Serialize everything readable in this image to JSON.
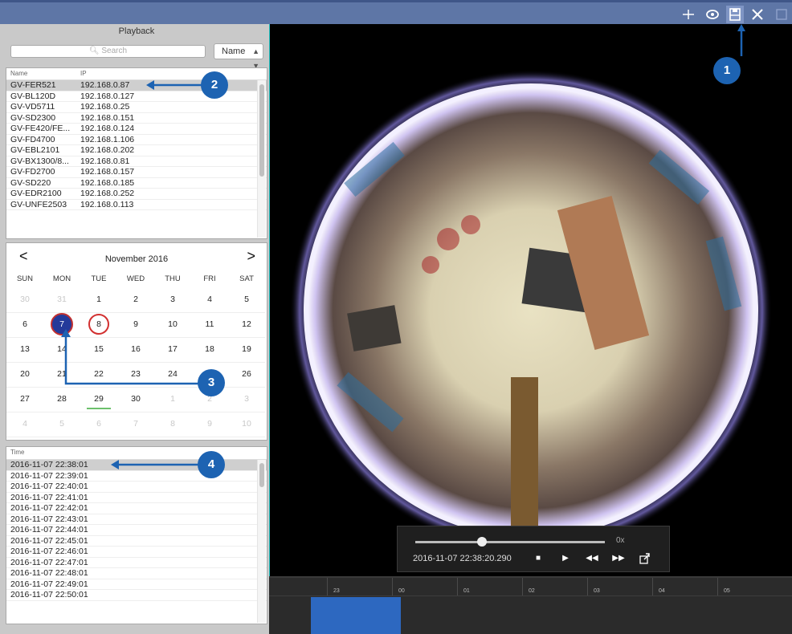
{
  "toolbar": {
    "icons": [
      "crosshair-icon",
      "eye-icon",
      "save-icon",
      "tools-icon",
      "window-icon"
    ]
  },
  "playback": {
    "title": "Playback",
    "search_placeholder": "Search",
    "sort": "Name"
  },
  "device_table": {
    "col_name": "Name",
    "col_ip": "IP",
    "rows": [
      {
        "name": "GV-FER521",
        "ip": "192.168.0.87"
      },
      {
        "name": "GV-BL120D",
        "ip": "192.168.0.127"
      },
      {
        "name": "GV-VD5711",
        "ip": "192.168.0.25"
      },
      {
        "name": "GV-SD2300",
        "ip": "192.168.0.151"
      },
      {
        "name": "GV-FE420/FE...",
        "ip": "192.168.0.124"
      },
      {
        "name": "GV-FD4700",
        "ip": "192.168.1.106"
      },
      {
        "name": "GV-EBL2101",
        "ip": "192.168.0.202"
      },
      {
        "name": "GV-BX1300/8...",
        "ip": "192.168.0.81"
      },
      {
        "name": "GV-FD2700",
        "ip": "192.168.0.157"
      },
      {
        "name": "GV-SD220",
        "ip": "192.168.0.185"
      },
      {
        "name": "GV-EDR2100",
        "ip": "192.168.0.252"
      },
      {
        "name": "GV-UNFE2503",
        "ip": "192.168.0.113"
      }
    ]
  },
  "calendar": {
    "prev": "<",
    "next": ">",
    "month": "November 2016",
    "weekdays": [
      "SUN",
      "MON",
      "TUE",
      "WED",
      "THU",
      "FRI",
      "SAT"
    ],
    "weeks": [
      [
        "30",
        "31",
        "1",
        "2",
        "3",
        "4",
        "5"
      ],
      [
        "6",
        "7",
        "8",
        "9",
        "10",
        "11",
        "12"
      ],
      [
        "13",
        "14",
        "15",
        "16",
        "17",
        "18",
        "19"
      ],
      [
        "20",
        "21",
        "22",
        "23",
        "24",
        "25",
        "26"
      ],
      [
        "27",
        "28",
        "29",
        "30",
        "1",
        "2",
        "3"
      ],
      [
        "4",
        "5",
        "6",
        "7",
        "8",
        "9",
        "10"
      ]
    ]
  },
  "time_list": {
    "header": "Time",
    "rows": [
      "2016-11-07 22:38:01",
      "2016-11-07 22:39:01",
      "2016-11-07 22:40:01",
      "2016-11-07 22:41:01",
      "2016-11-07 22:42:01",
      "2016-11-07 22:43:01",
      "2016-11-07 22:44:01",
      "2016-11-07 22:45:01",
      "2016-11-07 22:46:01",
      "2016-11-07 22:47:01",
      "2016-11-07 22:48:01",
      "2016-11-07 22:49:01",
      "2016-11-07 22:50:01"
    ]
  },
  "player": {
    "speed": "0x",
    "timestamp": "2016-11-07 22:38:20.290",
    "buttons": [
      "stop-icon",
      "play-icon",
      "rewind-icon",
      "fast-forward-icon",
      "export-icon"
    ],
    "progress": 0.35
  },
  "timeline": {
    "labels": [
      "23",
      "00",
      "01",
      "02",
      "03",
      "04",
      "05"
    ]
  },
  "callouts": [
    "1",
    "2",
    "3",
    "4"
  ]
}
